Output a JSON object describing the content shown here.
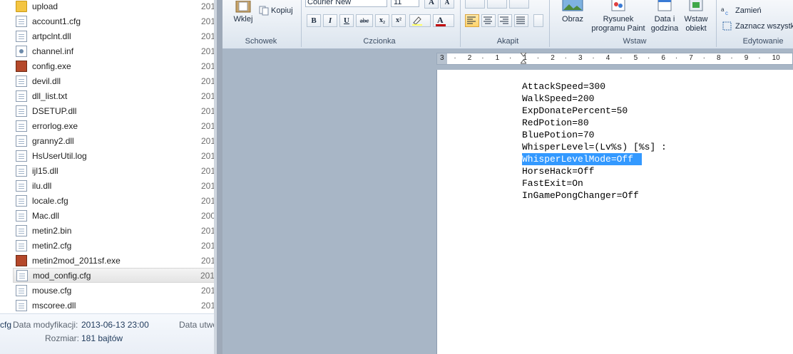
{
  "explorer": {
    "files": [
      {
        "name": "upload",
        "icon": "folder-icon",
        "date": "201"
      },
      {
        "name": "account1.cfg",
        "icon": "file-icon",
        "date": "201"
      },
      {
        "name": "artpclnt.dll",
        "icon": "file-icon",
        "date": "201"
      },
      {
        "name": "channel.inf",
        "icon": "config-file-icon",
        "date": "201"
      },
      {
        "name": "config.exe",
        "icon": "app-icon",
        "date": "201"
      },
      {
        "name": "devil.dll",
        "icon": "file-icon",
        "date": "201"
      },
      {
        "name": "dll_list.txt",
        "icon": "file-icon",
        "date": "201"
      },
      {
        "name": "DSETUP.dll",
        "icon": "file-icon",
        "date": "201"
      },
      {
        "name": "errorlog.exe",
        "icon": "file-icon",
        "date": "201"
      },
      {
        "name": "granny2.dll",
        "icon": "file-icon",
        "date": "201"
      },
      {
        "name": "HsUserUtil.log",
        "icon": "file-icon",
        "date": "201"
      },
      {
        "name": "ijl15.dll",
        "icon": "file-icon",
        "date": "201"
      },
      {
        "name": "ilu.dll",
        "icon": "file-icon",
        "date": "201"
      },
      {
        "name": "locale.cfg",
        "icon": "file-icon",
        "date": "201"
      },
      {
        "name": "Mac.dll",
        "icon": "file-icon",
        "date": "200"
      },
      {
        "name": "metin2.bin",
        "icon": "file-icon",
        "date": "201"
      },
      {
        "name": "metin2.cfg",
        "icon": "file-icon",
        "date": "201"
      },
      {
        "name": "metin2mod_2011sf.exe",
        "icon": "app-icon",
        "date": "201"
      },
      {
        "name": "mod_config.cfg",
        "icon": "file-icon",
        "date": "201"
      },
      {
        "name": "mouse.cfg",
        "icon": "file-icon",
        "date": "201"
      },
      {
        "name": "mscoree.dll",
        "icon": "file-icon",
        "date": "201"
      }
    ],
    "selected_index": 18,
    "details": {
      "name_fragment": "cfg",
      "modified_label": "Data modyfikacji:",
      "modified_value": "2013-06-13 23:00",
      "created_label": "Data utwo",
      "size_label": "Rozmiar:",
      "size_value": "181 bajtów"
    }
  },
  "ribbon": {
    "paste_label": "Wklej",
    "copy_label": "Kopiuj",
    "clipboard_group": "Schowek",
    "font_name": "Courier New",
    "font_size": "11",
    "font_group": "Czcionka",
    "paragraph_group": "Akapit",
    "picture_label": "Obraz",
    "paint_label_1": "Rysunek",
    "paint_label_2": "programu Paint",
    "datetime_label_1": "Data i",
    "datetime_label_2": "godzina",
    "object_label_1": "Wstaw",
    "object_label_2": "obiekt",
    "insert_group": "Wstaw",
    "replace_label": "Zamień",
    "select_all_label": "Zaznacz wszystk",
    "editing_group": "Edytowanie",
    "bold": "B",
    "italic": "I",
    "underline": "U",
    "strike": "abc",
    "subscript": "x₂",
    "superscript": "x²",
    "grow": "A",
    "shrink": "A"
  },
  "ruler": {
    "labels": [
      "3",
      "·",
      "2",
      "·",
      "1",
      "·",
      "1",
      "·",
      "2",
      "·",
      "3",
      "·",
      "4",
      "·",
      "5",
      "·",
      "6",
      "·",
      "7",
      "·",
      "8",
      "·",
      "9",
      "·",
      "10"
    ]
  },
  "document": {
    "lines": [
      "AttackSpeed=300",
      "WalkSpeed=200",
      "ExpDonatePercent=50",
      "RedPotion=80",
      "BluePotion=70",
      "WhisperLevel=(Lv%s) [%s] :",
      "WhisperLevelMode=Off",
      "HorseHack=Off",
      "FastExit=On",
      "InGamePongChanger=Off"
    ],
    "selected_line": 6
  }
}
